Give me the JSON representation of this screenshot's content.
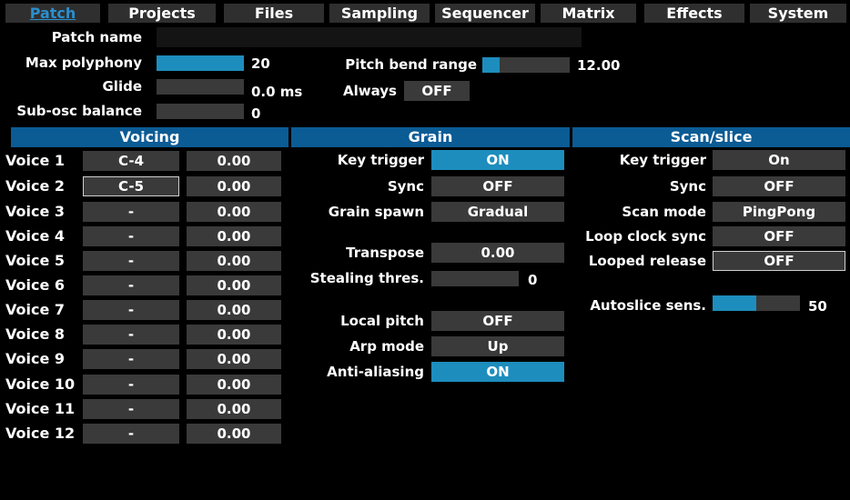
{
  "tabs": [
    {
      "label": "Patch",
      "active": true
    },
    {
      "label": "Projects"
    },
    {
      "label": "Files"
    },
    {
      "label": "Sampling"
    },
    {
      "label": "Sequencer"
    },
    {
      "label": "Matrix"
    },
    {
      "label": "Effects"
    },
    {
      "label": "System"
    }
  ],
  "patch": {
    "name_label": "Patch name",
    "name_value": "",
    "max_poly_label": "Max polyphony",
    "max_poly_value": "20",
    "max_poly_fraction": 1.0,
    "glide_label": "Glide",
    "glide_value": "0.0 ms",
    "glide_fraction": 0,
    "subosc_label": "Sub-osc balance",
    "subosc_value": "0",
    "subosc_fraction": 0,
    "pitchbend_label": "Pitch bend range",
    "pitchbend_value": "12.00",
    "pitchbend_fraction": 0.2,
    "always_label": "Always",
    "always_value": "OFF"
  },
  "sections": {
    "voicing": "Voicing",
    "grain": "Grain",
    "scan": "Scan/slice"
  },
  "voices": [
    {
      "label": "Voice 1",
      "note": "C-4",
      "value": "0.00"
    },
    {
      "label": "Voice 2",
      "note": "C-5",
      "value": "0.00",
      "selected": true
    },
    {
      "label": "Voice 3",
      "note": "-",
      "value": "0.00"
    },
    {
      "label": "Voice 4",
      "note": "-",
      "value": "0.00"
    },
    {
      "label": "Voice 5",
      "note": "-",
      "value": "0.00"
    },
    {
      "label": "Voice 6",
      "note": "-",
      "value": "0.00"
    },
    {
      "label": "Voice 7",
      "note": "-",
      "value": "0.00"
    },
    {
      "label": "Voice 8",
      "note": "-",
      "value": "0.00"
    },
    {
      "label": "Voice 9",
      "note": "-",
      "value": "0.00"
    },
    {
      "label": "Voice 10",
      "note": "-",
      "value": "0.00"
    },
    {
      "label": "Voice 11",
      "note": "-",
      "value": "0.00"
    },
    {
      "label": "Voice 12",
      "note": "-",
      "value": "0.00"
    }
  ],
  "grain": {
    "key_trigger_label": "Key trigger",
    "key_trigger_value": "ON",
    "sync_label": "Sync",
    "sync_value": "OFF",
    "spawn_label": "Grain spawn",
    "spawn_value": "Gradual",
    "transpose_label": "Transpose",
    "transpose_value": "0.00",
    "stealing_label": "Stealing thres.",
    "stealing_value": "0",
    "stealing_fraction": 0,
    "local_pitch_label": "Local pitch",
    "local_pitch_value": "OFF",
    "arp_label": "Arp mode",
    "arp_value": "Up",
    "antialias_label": "Anti-aliasing",
    "antialias_value": "ON"
  },
  "scan": {
    "key_trigger_label": "Key trigger",
    "key_trigger_value": "On",
    "sync_label": "Sync",
    "sync_value": "OFF",
    "mode_label": "Scan mode",
    "mode_value": "PingPong",
    "loop_clock_label": "Loop clock sync",
    "loop_clock_value": "OFF",
    "looped_release_label": "Looped release",
    "looped_release_value": "OFF",
    "autoslice_label": "Autoslice sens.",
    "autoslice_value": "50",
    "autoslice_fraction": 0.5
  },
  "colors": {
    "accent": "#1d8dbd",
    "header": "#0b5b95",
    "field": "#3a3a3a",
    "tab_active": "#2a8fd0"
  }
}
